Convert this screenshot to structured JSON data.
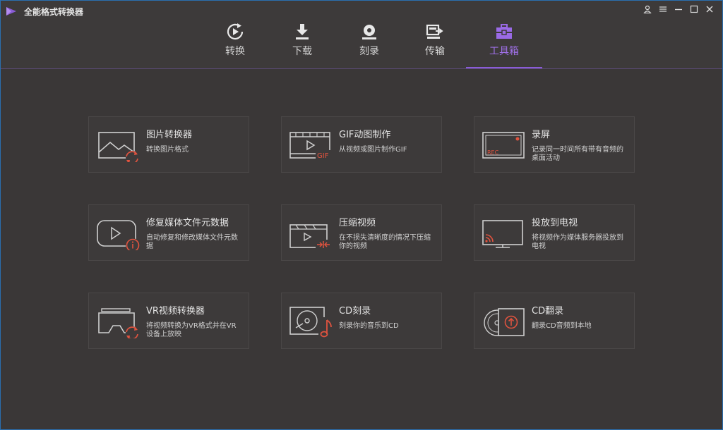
{
  "app": {
    "title": "全能格式转换器"
  },
  "tabs": [
    {
      "label": "转换",
      "icon": "convert-icon"
    },
    {
      "label": "下载",
      "icon": "download-icon"
    },
    {
      "label": "刻录",
      "icon": "burn-disc-icon"
    },
    {
      "label": "传输",
      "icon": "transfer-icon"
    },
    {
      "label": "工具箱",
      "icon": "toolbox-icon",
      "active": true
    }
  ],
  "colors": {
    "accent": "#8a5cd6",
    "icon_red": "#e0533f",
    "background": "#3a3737",
    "card_bg": "#3d3a3a"
  },
  "tools": [
    {
      "title": "图片转换器",
      "desc": "转换图片格式",
      "icon": "image-convert-icon"
    },
    {
      "title": "GIF动图制作",
      "desc": "从视频或图片制作GIF",
      "icon": "gif-maker-icon"
    },
    {
      "title": "录屏",
      "desc": "记录同一时间所有带有音频的桌面活动",
      "icon": "screen-record-icon"
    },
    {
      "title": "修复媒体文件元数据",
      "desc": "自动修复和修改媒体文件元数据",
      "icon": "fix-metadata-icon"
    },
    {
      "title": "压缩视频",
      "desc": "在不损失清晰度的情况下压缩你的视频",
      "icon": "compress-video-icon"
    },
    {
      "title": "投放到电视",
      "desc": "将视频作为媒体服务器投放到电视",
      "icon": "cast-tv-icon"
    },
    {
      "title": "VR视频转换器",
      "desc": "将视频转换为VR格式并在VR设备上放映",
      "icon": "vr-convert-icon"
    },
    {
      "title": "CD刻录",
      "desc": "刻录你的音乐到CD",
      "icon": "cd-burn-icon"
    },
    {
      "title": "CD翻录",
      "desc": "翻录CD音频到本地",
      "icon": "cd-rip-icon"
    }
  ]
}
